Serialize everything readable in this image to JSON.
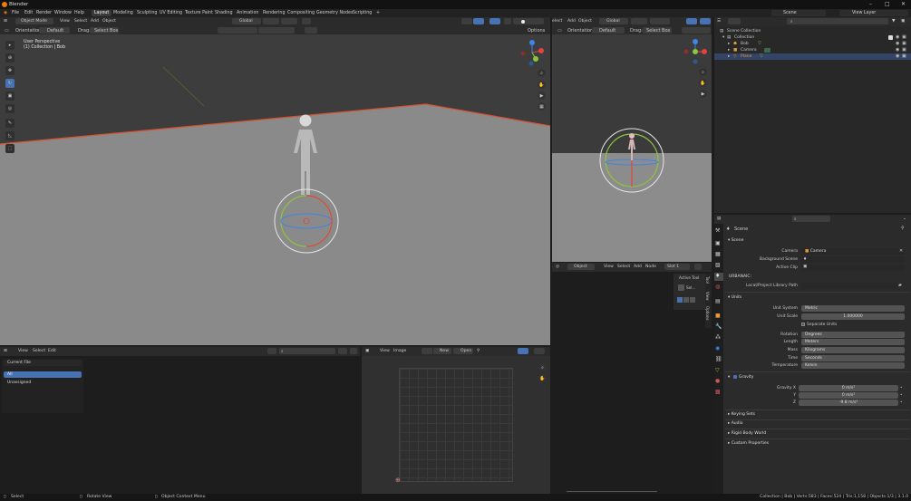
{
  "window": {
    "title": "Blender"
  },
  "menu": [
    "File",
    "Edit",
    "Render",
    "Window",
    "Help"
  ],
  "workspaces": [
    "Layout",
    "Modeling",
    "Sculpting",
    "UV Editing",
    "Texture Paint",
    "Shading",
    "Animation",
    "Rendering",
    "Compositing",
    "Geometry Nodes",
    "Scripting"
  ],
  "workspace_add": "+",
  "top_right": {
    "scene": "Scene",
    "view_layer": "View Layer"
  },
  "viewport_main": {
    "mode": "Object Mode",
    "menus": [
      "View",
      "Select",
      "Add",
      "Object"
    ],
    "orientation_label": "Orientation:",
    "orientation": "Default",
    "drag_label": "Drag:",
    "drag": "Select Box",
    "transform": "Global",
    "options": "Options",
    "overlay_title": "User Perspective",
    "overlay_sub": "(1) Collection | Bob"
  },
  "viewport_right": {
    "menus": [
      "elect",
      "Add",
      "Object"
    ],
    "orientation_label": "Orientation:",
    "orientation": "Default",
    "drag_label": "Drag:",
    "drag": "Select Box",
    "transform": "Global"
  },
  "outliner": {
    "root": "Scene Collection",
    "collection": "Collection",
    "items": [
      "Bob",
      "Camera",
      "Plane"
    ]
  },
  "node_editor": {
    "menus": [
      "View",
      "Select",
      "Add",
      "Node"
    ],
    "object": "Object",
    "slot": "Slot 1",
    "sidebar_tabs": [
      "Tool",
      "View",
      "Options"
    ],
    "active_tool": "Active Tool",
    "tool_name": "Sel..."
  },
  "asset_panel": {
    "menus": [
      "View",
      "Select",
      "Edit"
    ],
    "current_file": "Current File",
    "all": "All",
    "unassigned": "Unassigned"
  },
  "image_editor": {
    "menus": [
      "View",
      "Image"
    ],
    "new": "New",
    "open": "Open"
  },
  "properties": {
    "scene_name": "Scene",
    "section_scene": "Scene",
    "camera_label": "Camera",
    "camera_value": "Camera",
    "bg_scene_label": "Background Scene",
    "active_clip_label": "Active Clip",
    "urbanaic": "URBANAIC:",
    "lib_path_label": "Local/Project Library Path",
    "units_header": "Units",
    "unit_system_label": "Unit System",
    "unit_system": "Metric",
    "unit_scale_label": "Unit Scale",
    "unit_scale": "1.000000",
    "separate_units": "Separate Units",
    "rotation_label": "Rotation",
    "rotation": "Degrees",
    "length_label": "Length",
    "length": "Meters",
    "mass_label": "Mass",
    "mass": "Kilograms",
    "time_label": "Time",
    "time": "Seconds",
    "temp_label": "Temperature",
    "temp": "Kelvin",
    "gravity_header": "Gravity",
    "gx_label": "Gravity X",
    "gx": "0 m/s²",
    "gy_label": "Y",
    "gy": "0 m/s²",
    "gz_label": "Z",
    "gz": "-9.8 m/s²",
    "collapsed": [
      "Keying Sets",
      "Audio",
      "Rigid Body World",
      "Custom Properties"
    ]
  },
  "status_bar": {
    "select": "Select",
    "rotate": "Rotate View",
    "context": "Object Context Menu",
    "stats": "Collection | Bob | Verts:583 | Faces:524 | Tris:1,158 | Objects:1/3 | 3.1.0"
  },
  "colors": {
    "accent": "#4772b3",
    "plane_edge": "#d8532f",
    "x_axis": "#e0443b",
    "y_axis": "#8cc63e",
    "z_axis": "#3f84e6"
  }
}
